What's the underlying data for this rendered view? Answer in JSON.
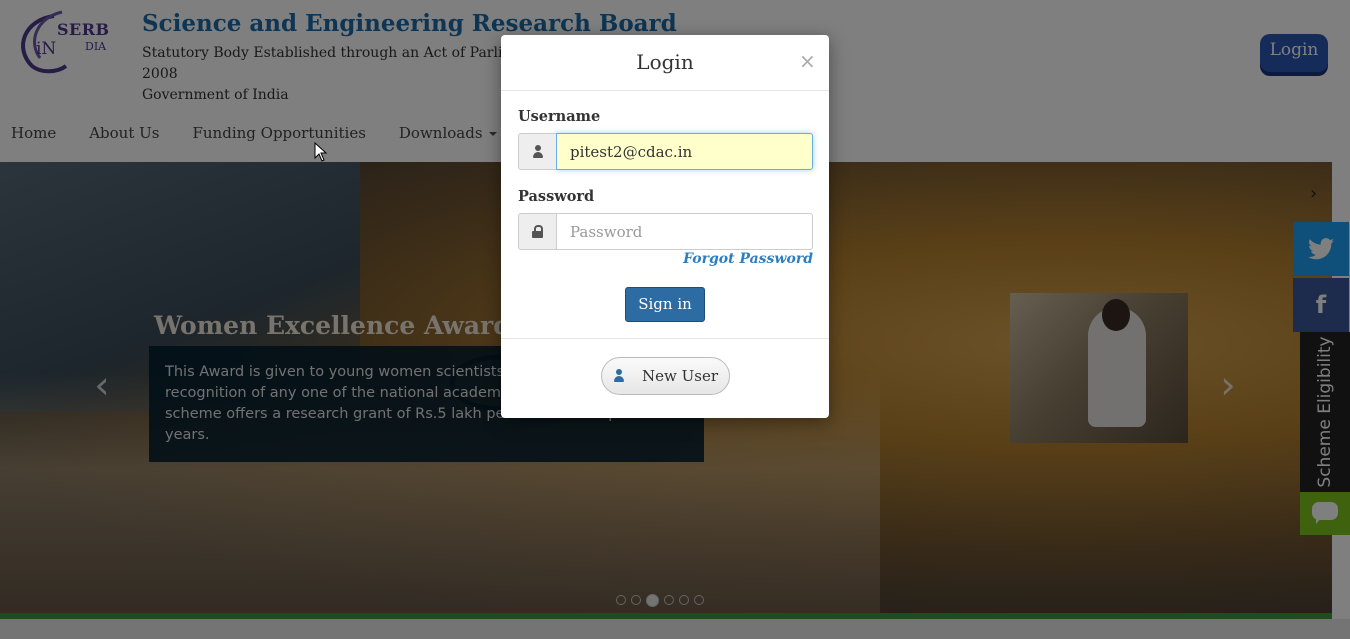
{
  "header": {
    "logo_text": "SERB",
    "logo_sub": "DIA",
    "logo_letters": "iN",
    "title": "Science and Engineering Research Board",
    "subtitle_lines": [
      "Statutory Body Established through an Act of Parliament:",
      "2008",
      "Government of India"
    ],
    "login_button": "Login"
  },
  "nav": {
    "items": [
      "Home",
      "About Us",
      "Funding Opportunities",
      "Downloads"
    ]
  },
  "carousel": {
    "slide_title": "Women Excellence Award",
    "slide_caption": "This Award is given to young women scientists who have received recognition of any one of the national academies of the country. The scheme offers a research grant of Rs.5 lakh per annum for a period of 3 years.",
    "active_dot": 3,
    "dot_count": 6
  },
  "social": {
    "twitter_icon": "twitter-icon",
    "facebook_icon": "facebook-icon",
    "scheme_label": "Scheme Eligibility",
    "chat_icon": "chat-icon"
  },
  "modal": {
    "title": "Login",
    "close_symbol": "×",
    "username_label": "Username",
    "username_value": "pitest2@cdac.in",
    "password_label": "Password",
    "password_placeholder": "Password",
    "forgot_link": "Forgot Password",
    "signin_button": "Sign in",
    "new_user_button": "New User"
  },
  "colors": {
    "title_blue": "#1c6aa6",
    "signin_blue": "#2d6ca2",
    "twitter": "#1da1f2",
    "facebook": "#3b5998",
    "chat_green": "#7cc51d",
    "highlight_yellow": "#ffffcc"
  }
}
